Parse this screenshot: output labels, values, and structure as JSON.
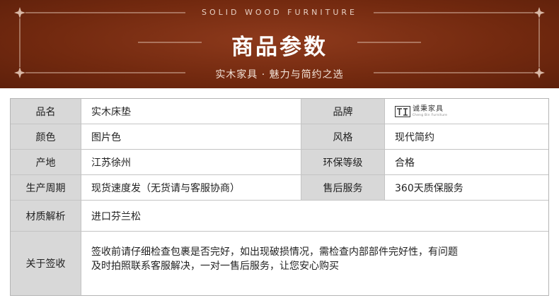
{
  "banner": {
    "en_title": "SOLID WOOD FURNITURE",
    "cn_title": "商品参数",
    "subtitle": "实木家具 · 魅力与简约之选",
    "colors": {
      "background": "#72290f",
      "frame_line": "#d9b8a6",
      "text": "#ffffff"
    }
  },
  "table": {
    "rows": [
      {
        "label1": "品名",
        "value1": "实木床垫",
        "label2": "品牌",
        "value2_logo": "brand-logo-icon"
      },
      {
        "label1": "颜色",
        "value1": "图片色",
        "label2": "风格",
        "value2": "现代简约"
      },
      {
        "label1": "产地",
        "value1": "江苏徐州",
        "label2": "环保等级",
        "value2": "合格"
      },
      {
        "label1": "生产周期",
        "value1": "现货速度发（无货请与客服协商）",
        "label2": "售后服务",
        "value2": "360天质保服务"
      }
    ],
    "material": {
      "label": "材质解析",
      "value": "进口芬兰松"
    },
    "sign": {
      "label": "关于签收",
      "line1": "签收前请仔细检查包裹是否完好，如出现破损情况，需检查内部部件完好性，有问题",
      "line2": "及时拍照联系客服解决，一对一售后服务，让您安心购买"
    },
    "colors": {
      "label_bg": "#d8d8d8",
      "border": "#b5b5b5"
    }
  },
  "brand": {
    "name_cn": "诚秉家具",
    "name_en": "Cheng Bin Furniture"
  }
}
